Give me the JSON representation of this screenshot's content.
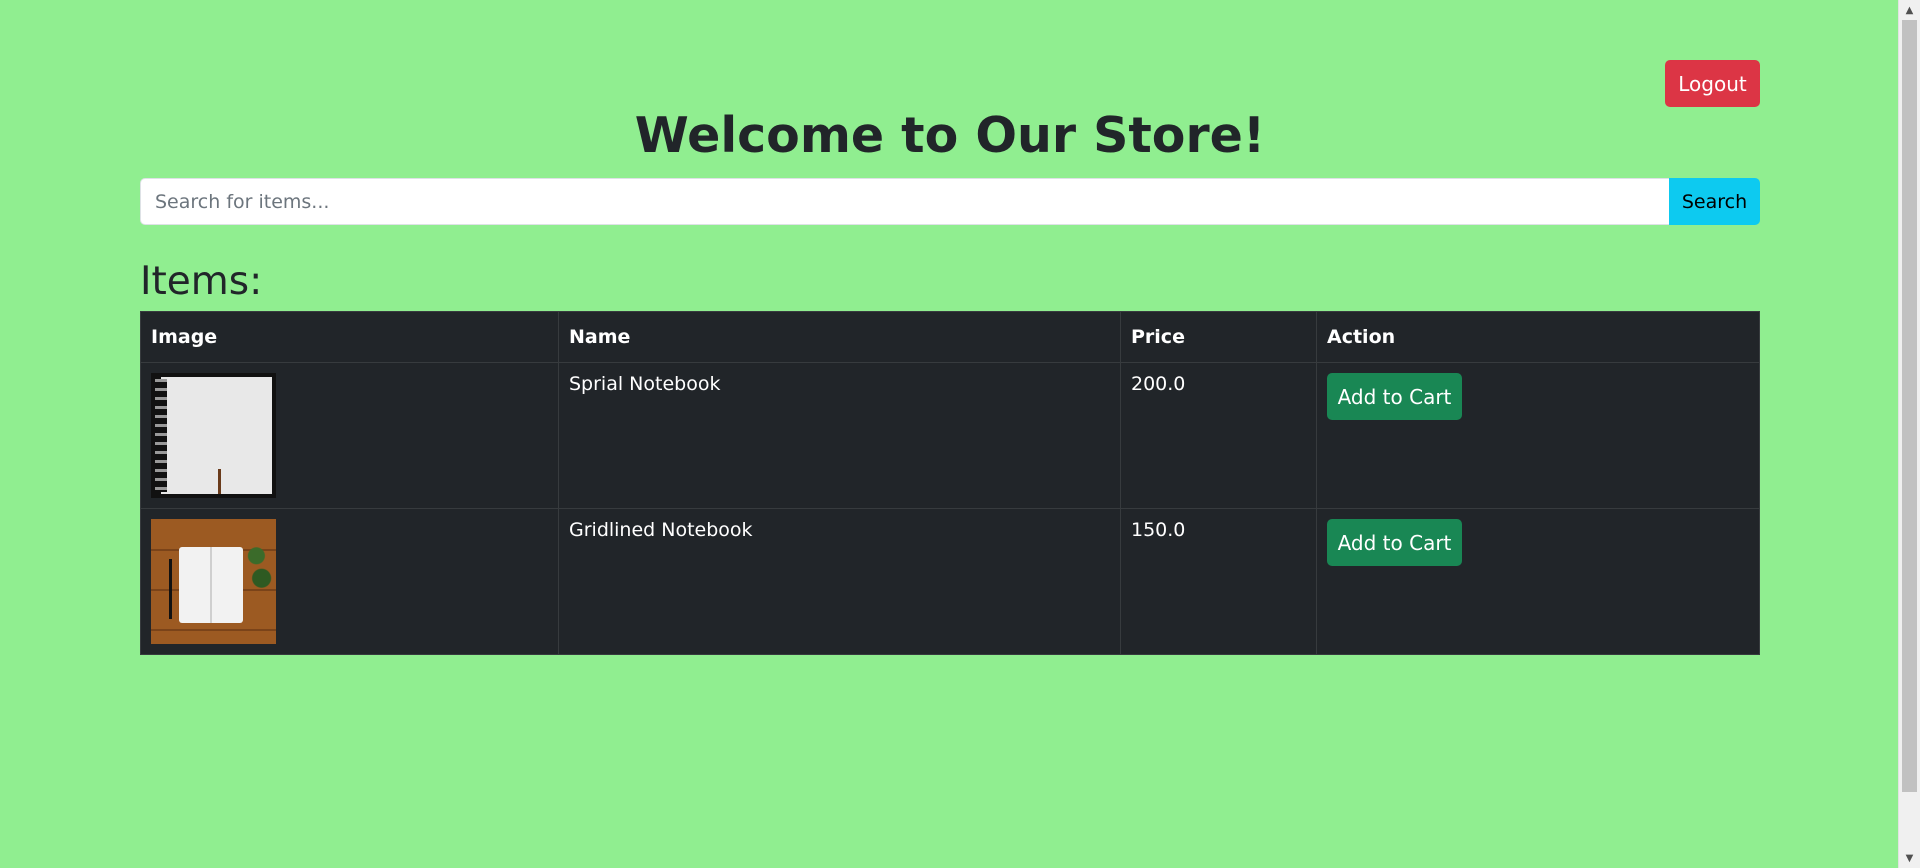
{
  "header": {
    "logout_label": "Logout",
    "title": "Welcome to Our Store!"
  },
  "search": {
    "placeholder": "Search for items...",
    "value": "",
    "button_label": "Search"
  },
  "items_section": {
    "heading": "Items:",
    "columns": [
      "Image",
      "Name",
      "Price",
      "Action"
    ],
    "rows": [
      {
        "image_icon": "spiral-notebook-image",
        "name": "Sprial Notebook",
        "price": "200.0",
        "action_label": "Add to Cart"
      },
      {
        "image_icon": "gridlined-notebook-image",
        "name": "Gridlined Notebook",
        "price": "150.0",
        "action_label": "Add to Cart"
      }
    ]
  },
  "colors": {
    "page_background": "#90ee90",
    "logout_button": "#dc3545",
    "search_button": "#0dcaf0",
    "table_background": "#212529",
    "cart_button": "#198754"
  }
}
